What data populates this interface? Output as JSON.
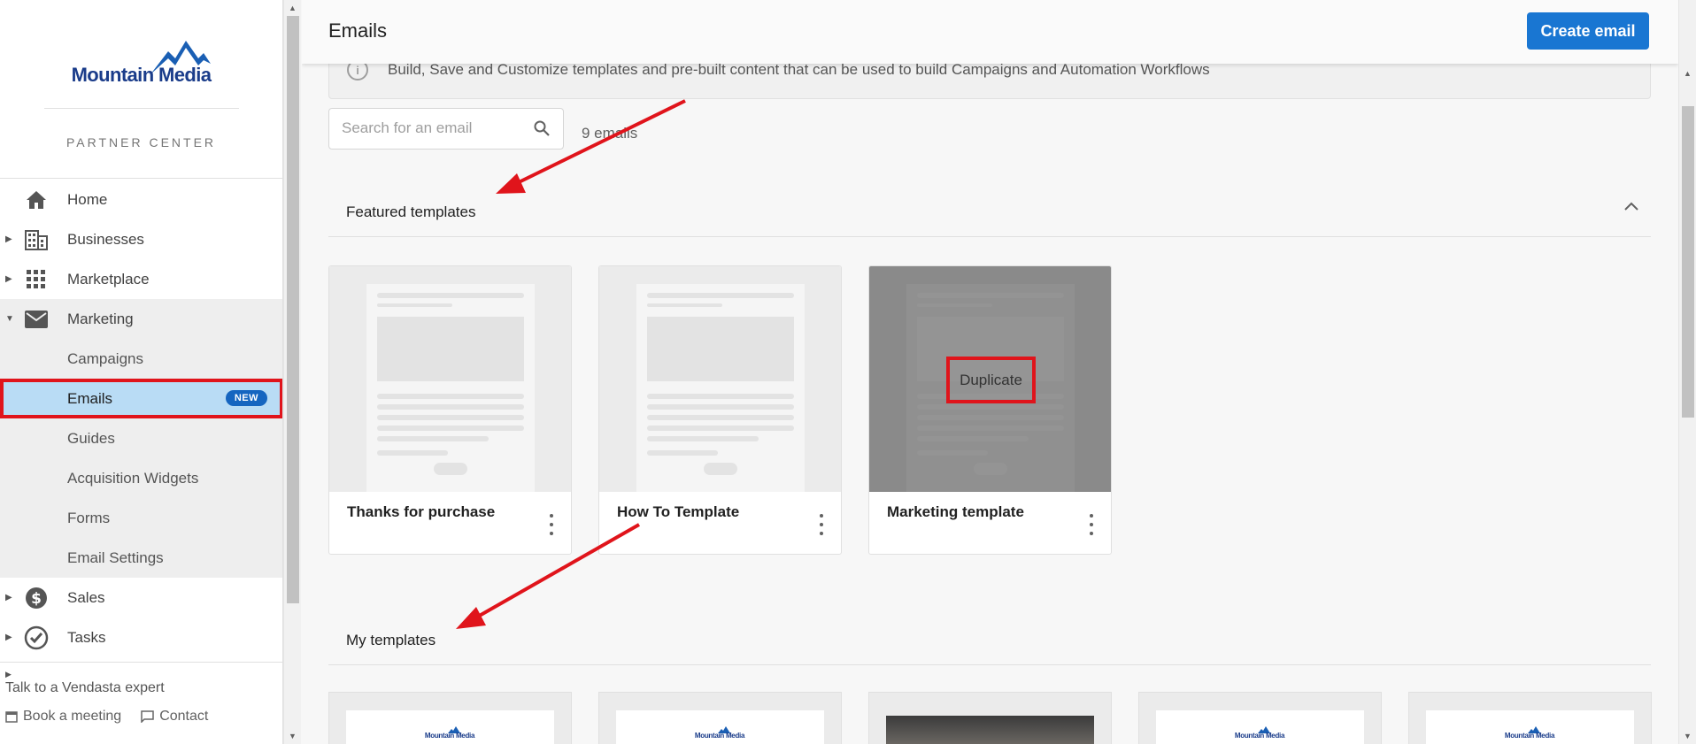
{
  "brand": {
    "name": "Mountain Media",
    "subtitle": "PARTNER CENTER"
  },
  "nav": {
    "home": "Home",
    "businesses": "Businesses",
    "marketplace": "Marketplace",
    "marketing": "Marketing",
    "marketing_sub": {
      "campaigns": "Campaigns",
      "emails": "Emails",
      "emails_badge": "NEW",
      "guides": "Guides",
      "acquisition_widgets": "Acquisition Widgets",
      "forms": "Forms",
      "email_settings": "Email Settings"
    },
    "sales": "Sales",
    "tasks": "Tasks"
  },
  "footer": {
    "expert": "Talk to a Vendasta expert",
    "book": "Book a meeting",
    "contact": "Contact"
  },
  "header": {
    "title": "Emails",
    "create_button": "Create email"
  },
  "info": {
    "text": "Build, Save and Customize templates and pre-built content that can be used to build Campaigns and Automation Workflows"
  },
  "search": {
    "placeholder": "Search for an email",
    "value": ""
  },
  "email_count": "9 emails",
  "featured": {
    "title": "Featured templates",
    "cards": [
      {
        "name": "Thanks for purchase"
      },
      {
        "name": "How To Template"
      },
      {
        "name": "Marketing template",
        "hover_action": "Duplicate"
      }
    ]
  },
  "my_templates": {
    "title": "My templates",
    "thumb_logo": "Mountain Media"
  },
  "colors": {
    "primary": "#1976d2",
    "active_nav": "#b9dcf5",
    "highlight": "#e0141b",
    "badge": "#1565c0"
  }
}
